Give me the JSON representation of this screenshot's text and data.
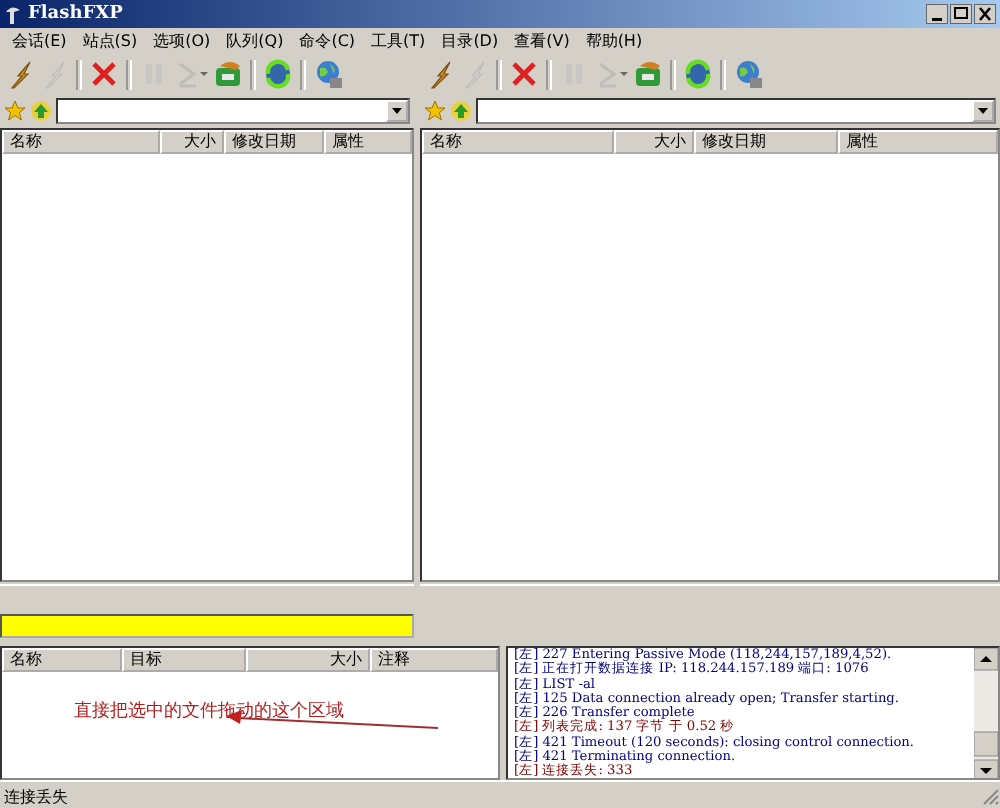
{
  "window": {
    "title": "FlashFXP"
  },
  "menu": [
    "会话(E)",
    "站点(S)",
    "选项(O)",
    "队列(Q)",
    "命令(C)",
    "工具(T)",
    "目录(D)",
    "查看(V)",
    "帮助(H)"
  ],
  "panes": [
    {
      "toolbar": [
        {
          "kind": "connect",
          "disabled": false
        },
        {
          "kind": "disconnect",
          "disabled": true
        },
        {
          "kind": "abort",
          "disabled": false
        },
        {
          "kind": "pause",
          "disabled": true
        },
        {
          "kind": "next",
          "disabled": true
        },
        {
          "kind": "transfer",
          "disabled": false
        },
        {
          "kind": "refresh",
          "disabled": false
        },
        {
          "kind": "site",
          "disabled": false
        }
      ],
      "columns": [
        "名称",
        "大小",
        "修改日期",
        "属性"
      ],
      "progress": {
        "level": 1
      }
    },
    {
      "toolbar": [
        {
          "kind": "connect",
          "disabled": false
        },
        {
          "kind": "disconnect",
          "disabled": true
        },
        {
          "kind": "abort",
          "disabled": false
        },
        {
          "kind": "pause",
          "disabled": true
        },
        {
          "kind": "next",
          "disabled": true
        },
        {
          "kind": "transfer",
          "disabled": false
        },
        {
          "kind": "refresh",
          "disabled": false
        },
        {
          "kind": "site",
          "disabled": false
        }
      ],
      "columns": [
        "名称",
        "大小",
        "修改日期",
        "属性"
      ]
    }
  ],
  "queue": {
    "columns": [
      "名称",
      "目标",
      "大小",
      "注释"
    ],
    "annotation": "直接把选中的文件拖动的这个区域"
  },
  "log": [
    {
      "text": "[左] 227 Entering Passive Mode (118,244,157,189,4,52).",
      "color": "#000080"
    },
    {
      "text": "[左] 正在打开数据连接 IP: 118.244.157.189 端口: 1076",
      "color": "#000080"
    },
    {
      "text": "[左] LIST -al",
      "color": "#000080"
    },
    {
      "text": "[左] 125 Data connection already open; Transfer starting.",
      "color": "#000080"
    },
    {
      "text": "[左] 226 Transfer complete",
      "color": "#000080"
    },
    {
      "text": "[左] 列表完成: 137 字节 于 0.52 秒",
      "color": "#800000"
    },
    {
      "text": "[左] 421 Timeout (120 seconds): closing control connection.",
      "color": "#000080"
    },
    {
      "text": "[左] 421 Terminating connection.",
      "color": "#000080"
    },
    {
      "text": "[左] 连接丢失: 333",
      "color": "#800000"
    }
  ],
  "status_bar": "连接丢失"
}
